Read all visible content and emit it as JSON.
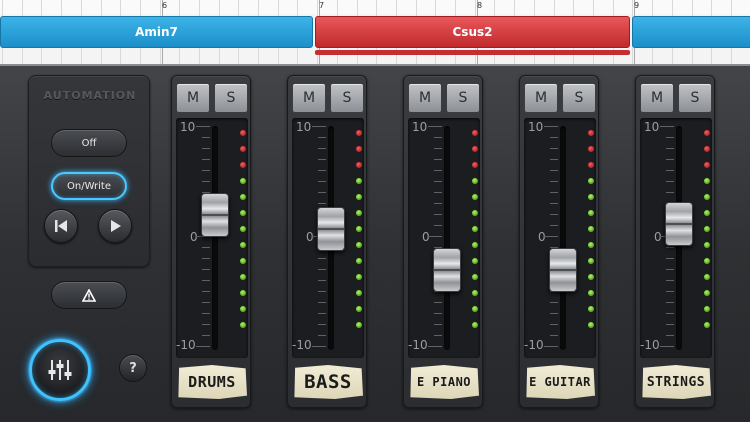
{
  "timeline": {
    "bar_numbers": [
      "6",
      "7",
      "8",
      "9"
    ],
    "chords": [
      {
        "label": "Amin7",
        "color": "#2a9fd8"
      },
      {
        "label": "Csus2",
        "color": "#d8393c"
      },
      {
        "label": "",
        "color": "#2a9fd8"
      }
    ]
  },
  "automation": {
    "title": "AUTOMATION",
    "off_label": "Off",
    "on_write_label": "On/Write",
    "on_write_active": true,
    "skip_back_icon": "skip-to-start-icon",
    "play_icon": "play-icon",
    "warning_icon": "warning-triangle-icon"
  },
  "mixer_button_icon": "mixer-sliders-icon",
  "help_label": "?",
  "scale": {
    "top": "10",
    "middle": "0",
    "bottom": "-10"
  },
  "channels": [
    {
      "name": "DRUMS",
      "mute_label": "M",
      "solo_label": "S",
      "fader_level": 0.63
    },
    {
      "name": "BASS",
      "mute_label": "M",
      "solo_label": "S",
      "fader_level": 0.55
    },
    {
      "name": "E PIANO",
      "mute_label": "M",
      "solo_label": "S",
      "fader_level": 0.32
    },
    {
      "name": "E GUITAR",
      "mute_label": "M",
      "solo_label": "S",
      "fader_level": 0.32
    },
    {
      "name": "STRINGS",
      "mute_label": "M",
      "solo_label": "S",
      "fader_level": 0.58
    }
  ],
  "colors": {
    "accent_glow": "#3ec3ff",
    "chord_blue": "#2a9fd8",
    "chord_red": "#d8393c",
    "led_red": "#e02222",
    "led_green": "#7ccc2c"
  }
}
